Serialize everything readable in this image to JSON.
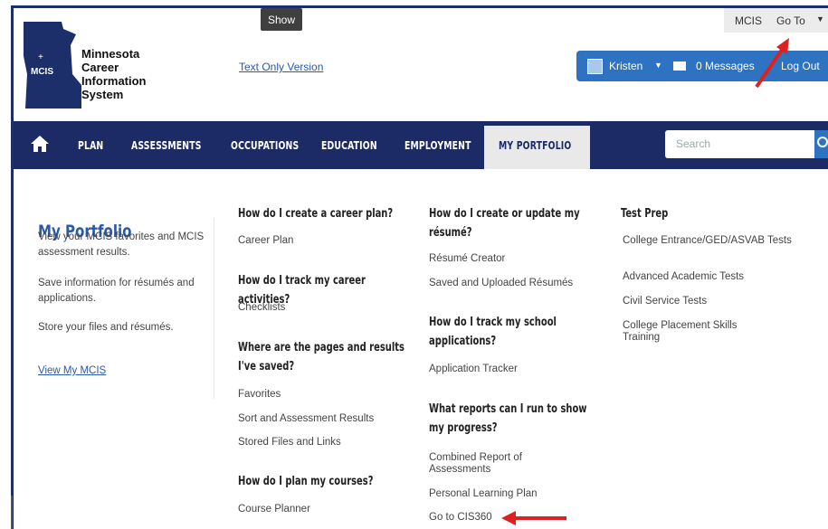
{
  "tooltip": "Show",
  "logo": {
    "abbr": "MCIS",
    "line1": "Minnesota",
    "line2": "Career",
    "line3": "Information",
    "line4": "System"
  },
  "text_only_link": "Text Only Version",
  "topbar": {
    "mcis": "MCIS",
    "goto": "Go To"
  },
  "userbar": {
    "name": "Kristen",
    "messages": "0 Messages",
    "logout": "Log Out"
  },
  "nav": {
    "items": [
      "PLAN",
      "ASSESSMENTS",
      "OCCUPATIONS",
      "EDUCATION",
      "EMPLOYMENT",
      "MY PORTFOLIO"
    ],
    "active": "MY PORTFOLIO",
    "search_placeholder": "Search"
  },
  "sidebar": {
    "title": "My Portfolio",
    "p1": "View your MCIS favorites and MCIS assessment results.",
    "p2": "Save information for résumés and applications.",
    "p3": "Store your files and résumés.",
    "link": "View My MCIS"
  },
  "col1": {
    "q1": "How do I create a career plan?",
    "q1_links": [
      "Career Plan"
    ],
    "q2": "How do I track my career activities?",
    "q2_links": [
      "Checklists"
    ],
    "q3": "Where are the pages and results I've saved?",
    "q3_links": [
      "Favorites",
      "Sort and Assessment Results",
      "Stored Files and Links"
    ],
    "q4": "How do I plan my courses?",
    "q4_links": [
      "Course Planner"
    ]
  },
  "col2": {
    "q1": "How do I create or update my résumé?",
    "q1_links": [
      "Résumé Creator",
      "Saved and Uploaded Résumés"
    ],
    "q2": "How do I track my school applications?",
    "q2_links": [
      "Application Tracker"
    ],
    "q3": "What reports can I run to show my progress?",
    "q3_links": [
      "Combined Report of Assessments",
      "Personal Learning Plan",
      "Go to CIS360"
    ]
  },
  "col3": {
    "title": "Test Prep",
    "links": [
      "College Entrance/GED/ASVAB Tests",
      "Advanced Academic Tests",
      "Civil Service Tests",
      "College Placement Skills Training"
    ]
  },
  "colors": {
    "nav": "#1c2b66",
    "accent": "#2a5aa8",
    "userbar": "#2d73c2",
    "arrow": "#e02020"
  }
}
